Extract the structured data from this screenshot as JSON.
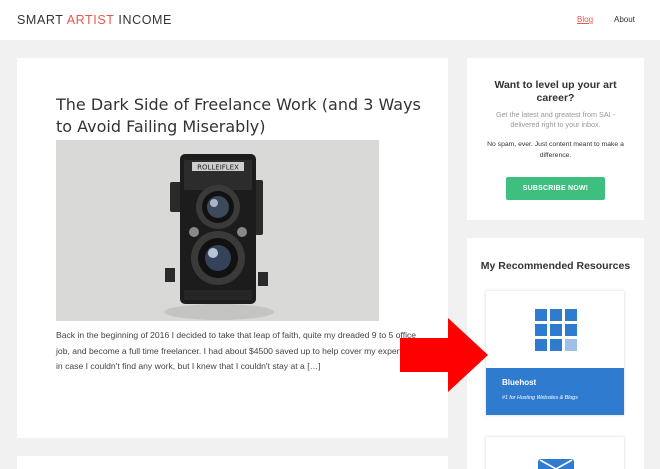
{
  "header": {
    "logo_part1": "SMART ",
    "logo_accent": "ARTIST",
    "logo_part2": " INCOME",
    "nav": [
      {
        "label": "Blog",
        "active": true
      },
      {
        "label": "About",
        "active": false
      }
    ]
  },
  "post": {
    "title": "The Dark Side of Freelance Work (and 3 Ways to Avoid Failing Miserably)",
    "excerpt": "Back in the beginning of 2016 I decided to take that leap of faith, quite my dreaded 9 to 5 office job, and become a full time freelancer. I had about $4500 saved up to help cover my expenses in case I couldn't find any work, but I knew that I couldn't stay at a […]",
    "image_brand": "ROLLEIFLEX"
  },
  "optin": {
    "title": "Want to level up your art career?",
    "subtitle": "Get the latest and greatest from SAI - delivered right to your inbox.",
    "note": "No spam, ever. Just content meant to make a difference.",
    "button_label": "SUBSCRIBE NOW!"
  },
  "resources": {
    "title": "My Recommended Resources",
    "items": [
      {
        "name": "Bluehost",
        "tagline": "#1 for Hosting Websites & Blogs",
        "icon": "grid-logo-icon"
      },
      {
        "name": "",
        "tagline": "",
        "icon": "mail-icon"
      }
    ]
  },
  "colors": {
    "accent": "#e8574b",
    "subscribe": "#3fbf7f",
    "bluehost": "#2f7bd0",
    "arrow": "#ff0000"
  }
}
